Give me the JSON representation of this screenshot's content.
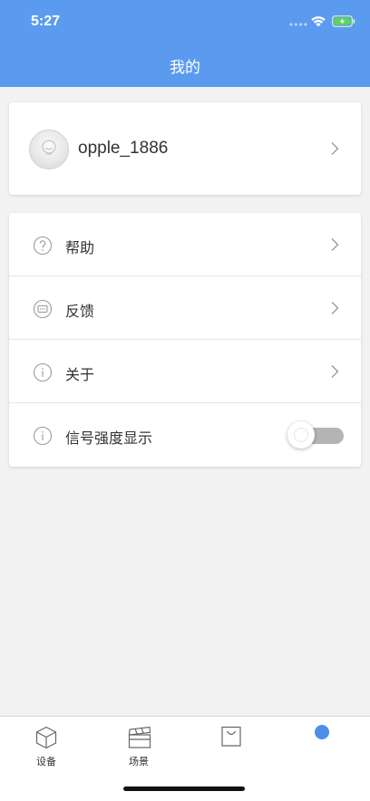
{
  "status_bar": {
    "time": "5:27"
  },
  "header": {
    "title": "我的",
    "background_color": "#5b9bef"
  },
  "profile": {
    "username": "opple_1886",
    "avatar_icon": "bulb-icon",
    "chevron_icon": "chevron-right-icon"
  },
  "menu": {
    "items": [
      {
        "label": "帮助",
        "icon": "help-circle-icon",
        "action": "chevron-right-icon"
      },
      {
        "label": "反馈",
        "icon": "feedback-icon",
        "action": "chevron-right-icon"
      },
      {
        "label": "关于",
        "icon": "info-icon",
        "action": "chevron-right-icon"
      },
      {
        "label": "信号强度显示",
        "icon": "info-icon",
        "action": "toggle",
        "toggle_on": false
      }
    ]
  },
  "tabbar": {
    "tabs": [
      {
        "label": "设备",
        "icon": "cube-icon"
      },
      {
        "label": "场景",
        "icon": "clapperboard-icon"
      },
      {
        "label": "",
        "icon": "shopping-bag-icon"
      },
      {
        "label": "",
        "icon": "profile-icon",
        "active": true
      }
    ],
    "active_color": "#4b8fea"
  }
}
